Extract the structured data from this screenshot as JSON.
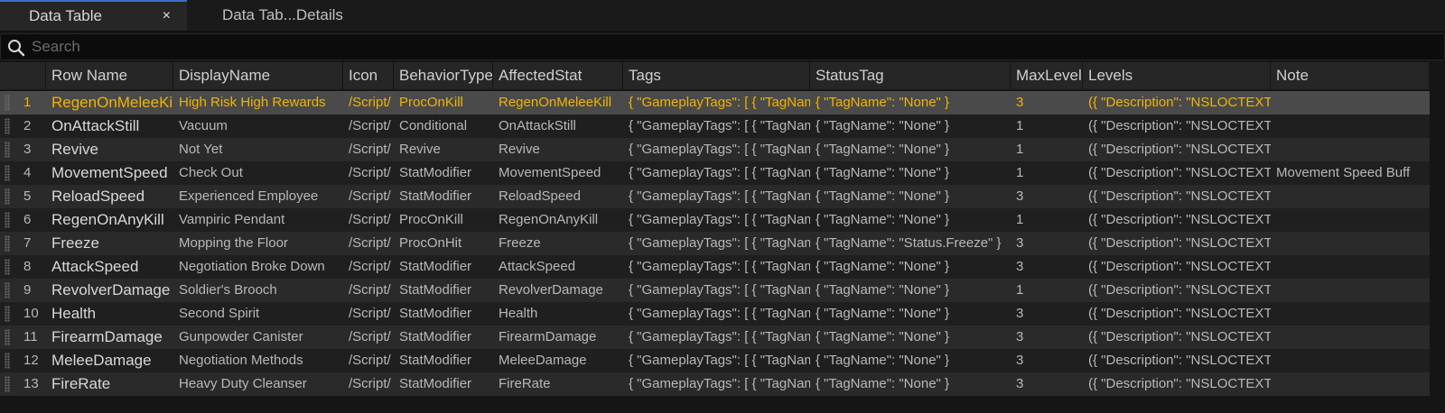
{
  "tabs": [
    {
      "label": "Data Table",
      "active": true,
      "close": "×"
    },
    {
      "label": "Data Tab...Details",
      "active": false
    }
  ],
  "search": {
    "placeholder": "Search",
    "value": ""
  },
  "colors": {
    "accent": "#3a6fc9",
    "selected_text": "#f0b400"
  },
  "table": {
    "columns": [
      "",
      "Row Name",
      "DisplayName",
      "Icon",
      "BehaviorType",
      "AffectedStat",
      "Tags",
      "StatusTag",
      "MaxLevel",
      "Levels",
      "Note"
    ],
    "rows": [
      {
        "idx": "1",
        "row_name": "RegenOnMeleeKill",
        "display_name": "High Risk High Rewards",
        "icon": "/Script/",
        "behavior": "ProcOnKill",
        "stat": "RegenOnMeleeKill",
        "tags": "{ \"GameplayTags\": [ { \"TagName",
        "status": "{ \"TagName\": \"None\" }",
        "max": "3",
        "levels": "({ \"Description\": \"NSLOCTEXT",
        "note": ""
      },
      {
        "idx": "2",
        "row_name": "OnAttackStill",
        "display_name": "Vacuum",
        "icon": "/Script/",
        "behavior": "Conditional",
        "stat": "OnAttackStill",
        "tags": "{ \"GameplayTags\": [ { \"TagName",
        "status": "{ \"TagName\": \"None\" }",
        "max": "1",
        "levels": "({ \"Description\": \"NSLOCTEXT",
        "note": ""
      },
      {
        "idx": "3",
        "row_name": "Revive",
        "display_name": "Not Yet",
        "icon": "/Script/",
        "behavior": "Revive",
        "stat": "Revive",
        "tags": "{ \"GameplayTags\": [ { \"TagName",
        "status": "{ \"TagName\": \"None\" }",
        "max": "1",
        "levels": "({ \"Description\": \"NSLOCTEXT",
        "note": ""
      },
      {
        "idx": "4",
        "row_name": "MovementSpeed",
        "display_name": "Check Out",
        "icon": "/Script/",
        "behavior": "StatModifier",
        "stat": "MovementSpeed",
        "tags": "{ \"GameplayTags\": [ { \"TagName",
        "status": "{ \"TagName\": \"None\" }",
        "max": "1",
        "levels": "({ \"Description\": \"NSLOCTEXT",
        "note": "Movement Speed Buff"
      },
      {
        "idx": "5",
        "row_name": "ReloadSpeed",
        "display_name": "Experienced Employee",
        "icon": "/Script/",
        "behavior": "StatModifier",
        "stat": "ReloadSpeed",
        "tags": "{ \"GameplayTags\": [ { \"TagName",
        "status": "{ \"TagName\": \"None\" }",
        "max": "3",
        "levels": "({ \"Description\": \"NSLOCTEXT",
        "note": ""
      },
      {
        "idx": "6",
        "row_name": "RegenOnAnyKill",
        "display_name": "Vampiric Pendant",
        "icon": "/Script/",
        "behavior": "ProcOnKill",
        "stat": "RegenOnAnyKill",
        "tags": "{ \"GameplayTags\": [ { \"TagName",
        "status": "{ \"TagName\": \"None\" }",
        "max": "1",
        "levels": "({ \"Description\": \"NSLOCTEXT",
        "note": ""
      },
      {
        "idx": "7",
        "row_name": "Freeze",
        "display_name": "Mopping the Floor",
        "icon": "/Script/",
        "behavior": "ProcOnHit",
        "stat": "Freeze",
        "tags": "{ \"GameplayTags\": [ { \"TagName",
        "status": "{ \"TagName\": \"Status.Freeze\" }",
        "max": "3",
        "levels": "({ \"Description\": \"NSLOCTEXT",
        "note": ""
      },
      {
        "idx": "8",
        "row_name": "AttackSpeed",
        "display_name": "Negotiation Broke Down",
        "icon": "/Script/",
        "behavior": "StatModifier",
        "stat": "AttackSpeed",
        "tags": "{ \"GameplayTags\": [ { \"TagName",
        "status": "{ \"TagName\": \"None\" }",
        "max": "3",
        "levels": "({ \"Description\": \"NSLOCTEXT",
        "note": ""
      },
      {
        "idx": "9",
        "row_name": "RevolverDamage",
        "display_name": "Soldier's Brooch",
        "icon": "/Script/",
        "behavior": "StatModifier",
        "stat": "RevolverDamage",
        "tags": "{ \"GameplayTags\": [ { \"TagName",
        "status": "{ \"TagName\": \"None\" }",
        "max": "1",
        "levels": "({ \"Description\": \"NSLOCTEXT",
        "note": ""
      },
      {
        "idx": "10",
        "row_name": "Health",
        "display_name": "Second Spirit",
        "icon": "/Script/",
        "behavior": "StatModifier",
        "stat": "Health",
        "tags": "{ \"GameplayTags\": [ { \"TagName",
        "status": "{ \"TagName\": \"None\" }",
        "max": "3",
        "levels": "({ \"Description\": \"NSLOCTEXT",
        "note": ""
      },
      {
        "idx": "11",
        "row_name": "FirearmDamage",
        "display_name": "Gunpowder Canister",
        "icon": "/Script/",
        "behavior": "StatModifier",
        "stat": "FirearmDamage",
        "tags": "{ \"GameplayTags\": [ { \"TagName",
        "status": "{ \"TagName\": \"None\" }",
        "max": "3",
        "levels": "({ \"Description\": \"NSLOCTEXT",
        "note": ""
      },
      {
        "idx": "12",
        "row_name": "MeleeDamage",
        "display_name": "Negotiation Methods",
        "icon": "/Script/",
        "behavior": "StatModifier",
        "stat": "MeleeDamage",
        "tags": "{ \"GameplayTags\": [ { \"TagName",
        "status": "{ \"TagName\": \"None\" }",
        "max": "3",
        "levels": "({ \"Description\": \"NSLOCTEXT",
        "note": ""
      },
      {
        "idx": "13",
        "row_name": "FireRate",
        "display_name": "Heavy Duty Cleanser",
        "icon": "/Script/",
        "behavior": "StatModifier",
        "stat": "FireRate",
        "tags": "{ \"GameplayTags\": [ { \"TagName",
        "status": "{ \"TagName\": \"None\" }",
        "max": "3",
        "levels": "({ \"Description\": \"NSLOCTEXT",
        "note": ""
      }
    ],
    "selected_row": 0
  }
}
